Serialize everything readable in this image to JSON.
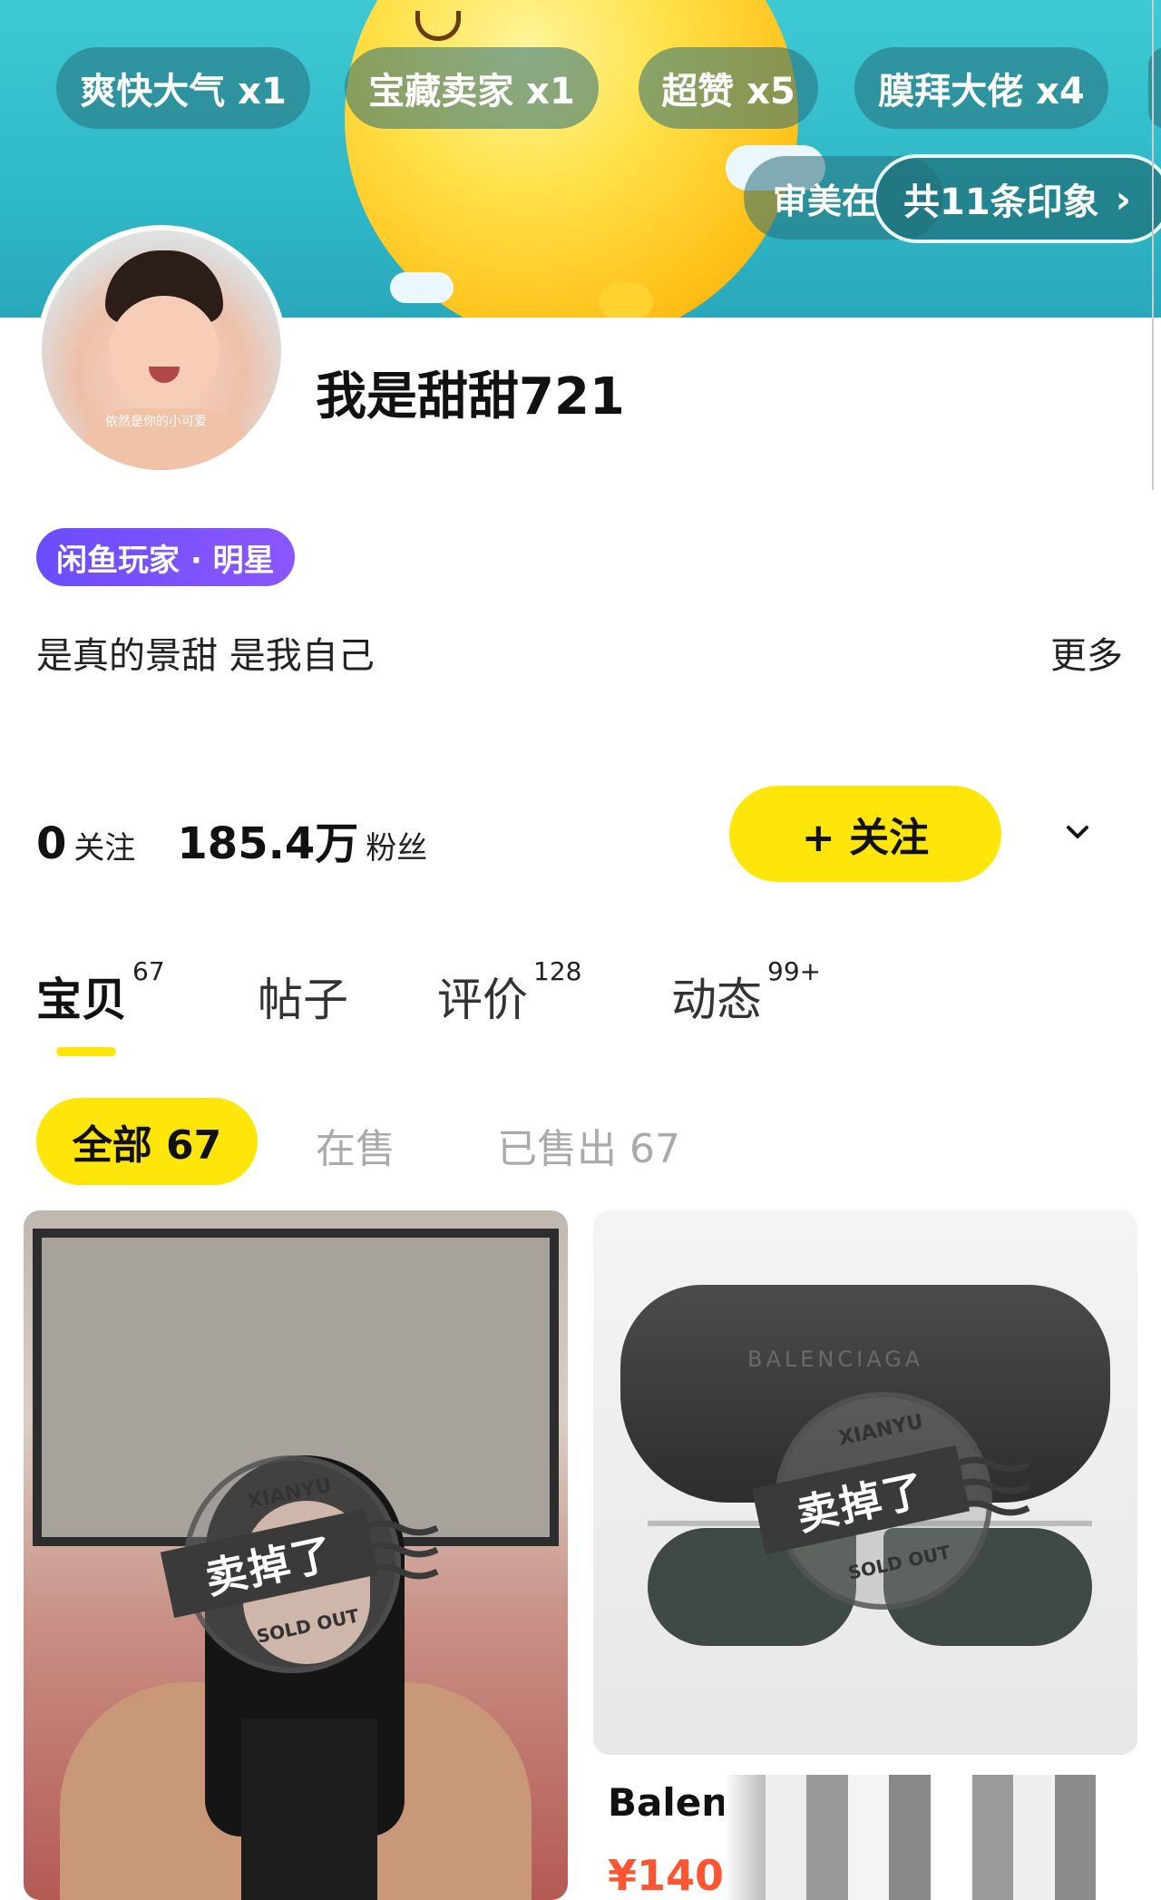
{
  "header": {
    "tags": [
      "爽快大气 x1",
      "宝藏卖家 x1",
      "超赞 x5",
      "膜拜大佬 x4"
    ],
    "partial_tag": "审美在",
    "impressions_label": "共11条印象",
    "impressions_chevron": "›"
  },
  "profile": {
    "username": "我是甜甜721",
    "avatar_caption": "依然是你的小可爱",
    "level_badge": "闲鱼玩家 · 明星",
    "bio": "是真的景甜 是我自己",
    "more_label": "更多"
  },
  "stats": {
    "following_count": "0",
    "following_label": "关注",
    "fans_count": "185.4万",
    "fans_label": "粉丝",
    "follow_button": "+ 关注"
  },
  "tabs": [
    {
      "label": "宝贝",
      "count": "67"
    },
    {
      "label": "帖子",
      "count": ""
    },
    {
      "label": "评价",
      "count": "128"
    },
    {
      "label": "动态",
      "count": "99+"
    }
  ],
  "filters": {
    "all": "全部 67",
    "on_sale": "在售",
    "sold": "已售出 67"
  },
  "products": [
    {
      "stamp": "卖掉了",
      "stamp_top": "XIANYU",
      "stamp_bottom": "SOLD OUT",
      "title": "",
      "price": ""
    },
    {
      "stamp": "卖掉了",
      "stamp_top": "XIANYU",
      "stamp_bottom": "SOLD OUT",
      "title": "Balen",
      "price": "¥140",
      "case_brand": "BALENCIAGA"
    }
  ],
  "colors": {
    "accent_yellow": "#ffe60a",
    "badge_purple": "#7a50ff",
    "price_orange": "#ff5533"
  }
}
